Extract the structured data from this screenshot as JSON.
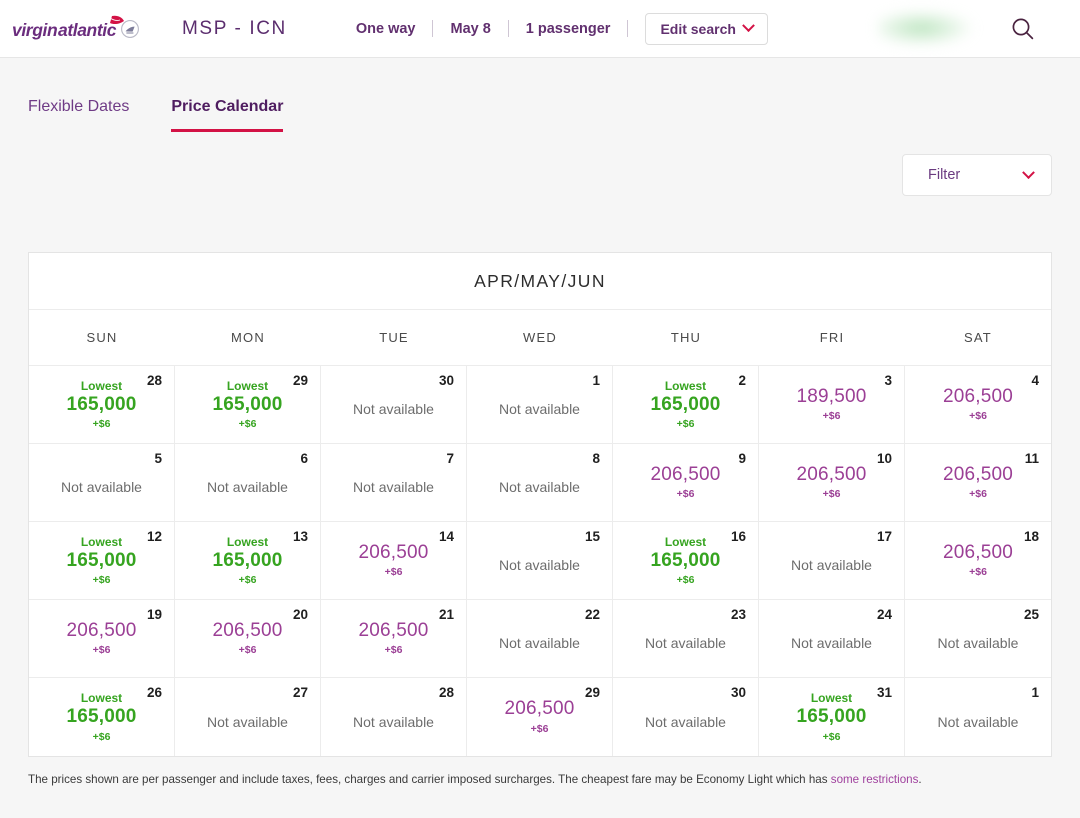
{
  "header": {
    "brand": "virgin atlantic",
    "route": "MSP - ICN",
    "trip_type": "One way",
    "date": "May 8",
    "passengers": "1 passenger",
    "edit_search_label": "Edit search",
    "search_icon": "search-icon",
    "chevron_icon": "chevron-down-icon"
  },
  "tabs": [
    {
      "label": "Flexible Dates",
      "active": false
    },
    {
      "label": "Price Calendar",
      "active": true
    }
  ],
  "filter": {
    "label": "Filter",
    "chevron_icon": "chevron-down-icon"
  },
  "calendar": {
    "title": "APR/MAY/JUN",
    "day_headers": [
      "SUN",
      "MON",
      "TUE",
      "WED",
      "THU",
      "FRI",
      "SAT"
    ],
    "lowest_label": "Lowest",
    "unavailable_label": "Not available",
    "surcharge": "+$6",
    "colors": {
      "lowest": "#36a420",
      "price": "#9b3f95",
      "accent": "#d31245",
      "brand_purple": "#61306f"
    },
    "cells": [
      {
        "day": "28",
        "price": "165,000",
        "surcharge": "+$6",
        "lowest": true,
        "available": true
      },
      {
        "day": "29",
        "price": "165,000",
        "surcharge": "+$6",
        "lowest": true,
        "available": true
      },
      {
        "day": "30",
        "price": null,
        "surcharge": null,
        "lowest": false,
        "available": false
      },
      {
        "day": "1",
        "price": null,
        "surcharge": null,
        "lowest": false,
        "available": false
      },
      {
        "day": "2",
        "price": "165,000",
        "surcharge": "+$6",
        "lowest": true,
        "available": true
      },
      {
        "day": "3",
        "price": "189,500",
        "surcharge": "+$6",
        "lowest": false,
        "available": true
      },
      {
        "day": "4",
        "price": "206,500",
        "surcharge": "+$6",
        "lowest": false,
        "available": true
      },
      {
        "day": "5",
        "price": null,
        "surcharge": null,
        "lowest": false,
        "available": false
      },
      {
        "day": "6",
        "price": null,
        "surcharge": null,
        "lowest": false,
        "available": false
      },
      {
        "day": "7",
        "price": null,
        "surcharge": null,
        "lowest": false,
        "available": false
      },
      {
        "day": "8",
        "price": null,
        "surcharge": null,
        "lowest": false,
        "available": false
      },
      {
        "day": "9",
        "price": "206,500",
        "surcharge": "+$6",
        "lowest": false,
        "available": true
      },
      {
        "day": "10",
        "price": "206,500",
        "surcharge": "+$6",
        "lowest": false,
        "available": true
      },
      {
        "day": "11",
        "price": "206,500",
        "surcharge": "+$6",
        "lowest": false,
        "available": true
      },
      {
        "day": "12",
        "price": "165,000",
        "surcharge": "+$6",
        "lowest": true,
        "available": true
      },
      {
        "day": "13",
        "price": "165,000",
        "surcharge": "+$6",
        "lowest": true,
        "available": true
      },
      {
        "day": "14",
        "price": "206,500",
        "surcharge": "+$6",
        "lowest": false,
        "available": true
      },
      {
        "day": "15",
        "price": null,
        "surcharge": null,
        "lowest": false,
        "available": false
      },
      {
        "day": "16",
        "price": "165,000",
        "surcharge": "+$6",
        "lowest": true,
        "available": true
      },
      {
        "day": "17",
        "price": null,
        "surcharge": null,
        "lowest": false,
        "available": false
      },
      {
        "day": "18",
        "price": "206,500",
        "surcharge": "+$6",
        "lowest": false,
        "available": true
      },
      {
        "day": "19",
        "price": "206,500",
        "surcharge": "+$6",
        "lowest": false,
        "available": true
      },
      {
        "day": "20",
        "price": "206,500",
        "surcharge": "+$6",
        "lowest": false,
        "available": true
      },
      {
        "day": "21",
        "price": "206,500",
        "surcharge": "+$6",
        "lowest": false,
        "available": true
      },
      {
        "day": "22",
        "price": null,
        "surcharge": null,
        "lowest": false,
        "available": false
      },
      {
        "day": "23",
        "price": null,
        "surcharge": null,
        "lowest": false,
        "available": false
      },
      {
        "day": "24",
        "price": null,
        "surcharge": null,
        "lowest": false,
        "available": false
      },
      {
        "day": "25",
        "price": null,
        "surcharge": null,
        "lowest": false,
        "available": false
      },
      {
        "day": "26",
        "price": "165,000",
        "surcharge": "+$6",
        "lowest": true,
        "available": true
      },
      {
        "day": "27",
        "price": null,
        "surcharge": null,
        "lowest": false,
        "available": false
      },
      {
        "day": "28",
        "price": null,
        "surcharge": null,
        "lowest": false,
        "available": false
      },
      {
        "day": "29",
        "price": "206,500",
        "surcharge": "+$6",
        "lowest": false,
        "available": true
      },
      {
        "day": "30",
        "price": null,
        "surcharge": null,
        "lowest": false,
        "available": false
      },
      {
        "day": "31",
        "price": "165,000",
        "surcharge": "+$6",
        "lowest": true,
        "available": true
      },
      {
        "day": "1",
        "price": null,
        "surcharge": null,
        "lowest": false,
        "available": false
      }
    ]
  },
  "footnote": {
    "text": "The prices shown are per passenger and include taxes, fees, charges and carrier imposed surcharges. The cheapest fare may be Economy Light which has ",
    "link_text": "some restrictions",
    "trailing": "."
  }
}
